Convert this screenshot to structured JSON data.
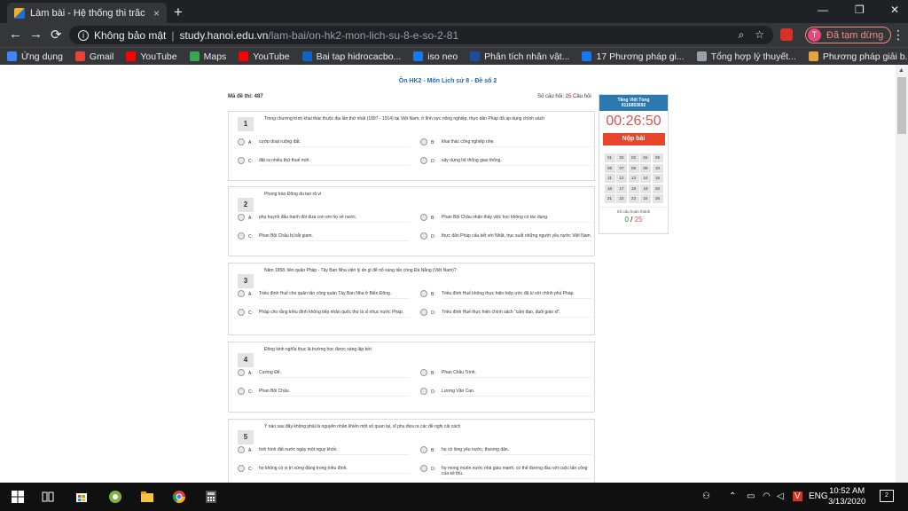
{
  "browser": {
    "tab_title": "Làm bài - Hệ thống thi trắc nghiệ",
    "tab_close": "×",
    "new_tab": "+",
    "win_min": "—",
    "win_max": "❐",
    "win_close": "✕",
    "nav_back": "←",
    "nav_forward": "→",
    "nav_reload": "⟳",
    "security_label": "Không bảo mật",
    "url_host": "study.hanoi.edu.vn",
    "url_path": "/lam-bai/on-hk2-mon-lich-su-8-e-so-2-81",
    "profile_initial": "T",
    "profile_label": "Đã tạm dừng",
    "menu": "⋮"
  },
  "bookmarks": [
    {
      "label": "Ứng dụng",
      "color": "#4285f4"
    },
    {
      "label": "Gmail",
      "color": "#ea4335"
    },
    {
      "label": "YouTube",
      "color": "#ff0000"
    },
    {
      "label": "Maps",
      "color": "#34a853"
    },
    {
      "label": "YouTube",
      "color": "#ff0000"
    },
    {
      "label": "Bai tap hidrocacbo...",
      "color": "#0a66c2"
    },
    {
      "label": "iso neo",
      "color": "#1877f2"
    },
    {
      "label": "Phân tích nhân vật...",
      "color": "#1a4e9c"
    },
    {
      "label": "17 Phương pháp gi...",
      "color": "#1877f2"
    },
    {
      "label": "Tổng hợp lý thuyết...",
      "color": "#9aa0a6"
    },
    {
      "label": "Phương pháp giải b...",
      "color": "#e8a33d"
    }
  ],
  "exam": {
    "title": "Ôn HK2 - Môn Lịch sử 8 - Đề số 2",
    "code_label": "Mã đề thi: 487",
    "count_prefix": "Số câu hỏi:",
    "count_value": "25",
    "count_suffix": "Câu hỏi"
  },
  "questions": [
    {
      "num": "1",
      "text": "Trong chương trình khai thác thuộc địa lần thứ nhất (1897 - 1914) tại Việt Nam, ở lĩnh vực nông nghiệp, thực dân Pháp đã áp dụng chính sách",
      "options": [
        {
          "label": "A:",
          "text": "cướp đoạt ruộng đất."
        },
        {
          "label": "B:",
          "text": "khai thác công nghiệp nhẹ."
        },
        {
          "label": "C:",
          "text": "đặt ra nhiều thứ thuế mới."
        },
        {
          "label": "D:",
          "text": "xây dựng hệ thống giao thông."
        }
      ]
    },
    {
      "num": "2",
      "text": "Phong trào Đông du tan rã vì",
      "options": [
        {
          "label": "A:",
          "text": "phụ huynh đấu tranh đòi đưa con em họ về nước."
        },
        {
          "label": "B:",
          "text": "Phan Bội Châu nhận thấy việc học không có tác dụng."
        },
        {
          "label": "C:",
          "text": "Phan Bội Châu bị bắt giam."
        },
        {
          "label": "D:",
          "text": "thực dân Pháp cấu kết với Nhật, trục xuất những người yêu nước Việt Nam."
        }
      ]
    },
    {
      "num": "3",
      "text": "Năm 1858, liên quân Pháp - Tây Ban Nha viện lý do gì để nổ súng tấn công Đà Nẵng (Việt Nam)?",
      "options": [
        {
          "label": "A:",
          "text": "Triều đình Huế cho quân tấn công quân Tây Ban Nha ở Biển Đông."
        },
        {
          "label": "B:",
          "text": "Triều đình Huế không thực hiện hiệp ước đã kí với chính phủ Pháp."
        },
        {
          "label": "C:",
          "text": "Pháp cho rằng triều đình không tiếp nhận quốc thư là sỉ nhục nước Pháp."
        },
        {
          "label": "D:",
          "text": "Triều đình Huế thực hiện chính sách “cấm đạo, đuổi giáo sĩ”."
        }
      ]
    },
    {
      "num": "4",
      "text": "Đông kinh nghĩa thục là trường học được sáng lập bởi",
      "options": [
        {
          "label": "A:",
          "text": "Cường Để."
        },
        {
          "label": "B:",
          "text": "Phan Châu Trinh."
        },
        {
          "label": "C:",
          "text": "Phan Bội Châu."
        },
        {
          "label": "D:",
          "text": "Lương Văn Can."
        }
      ]
    },
    {
      "num": "5",
      "text": "Ý nào sau đây không phải là nguyên nhân khiến một số quan lại, sĩ phu đưa ra các đề nghị cải cách",
      "options": [
        {
          "label": "A:",
          "text": "tình hình đất nước ngày một nguy khốn."
        },
        {
          "label": "B:",
          "text": "họ có lòng yêu nước, thương dân."
        },
        {
          "label": "C:",
          "text": "họ không có vị trí xứng đáng trong triều đình."
        },
        {
          "label": "D:",
          "text": "họ mong muốn nước nhà giàu mạnh, có thể đương đầu với cuộc tấn công của kẻ thù."
        }
      ]
    }
  ],
  "side": {
    "name": "Tăng Việt Tùng",
    "id": "0116853692",
    "timer": "00:26:50",
    "submit": "Nộp bài",
    "cells": [
      "01",
      "02",
      "03",
      "04",
      "05",
      "06",
      "07",
      "08",
      "09",
      "10",
      "11",
      "12",
      "13",
      "14",
      "15",
      "16",
      "17",
      "18",
      "19",
      "20",
      "21",
      "22",
      "23",
      "24",
      "25"
    ],
    "done_label": "Số câu hoàn thành",
    "done": "0",
    "slash": "/",
    "total": "25"
  },
  "taskbar": {
    "lang": "ENG",
    "time": "10:52 AM",
    "date": "3/13/2020",
    "notif_count": "2"
  }
}
